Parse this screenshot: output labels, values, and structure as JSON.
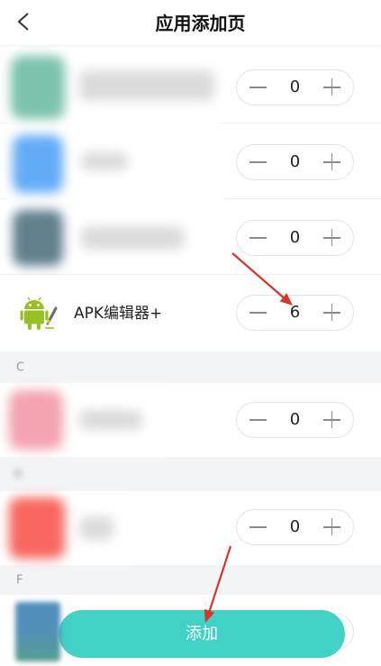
{
  "header": {
    "title": "应用添加页",
    "back_icon": "chevron-left-icon"
  },
  "apps": [
    {
      "icon_color": "#7dc2ad",
      "value": 0
    },
    {
      "icon_color": "#64abf6",
      "value": 0
    },
    {
      "icon_color": "#617f8d",
      "value": 0
    },
    {
      "icon": "android-edit-icon",
      "label": "APK编辑器+",
      "value": 6
    },
    {
      "icon_color": "#f3a3b0",
      "value": 0
    },
    {
      "icon_color": "#f7675f",
      "value": 0
    },
    {
      "icon_color": "#4f8fba"
    }
  ],
  "sections": [
    {
      "letter": "C"
    },
    {},
    {
      "letter": "F"
    }
  ],
  "stepper": {
    "decrement_icon": "minus-icon",
    "increment_icon": "plus-icon"
  },
  "add_button": {
    "label": "添加",
    "color": "#42d1c5"
  },
  "annotation": {
    "arrow_color": "#d9342b"
  }
}
